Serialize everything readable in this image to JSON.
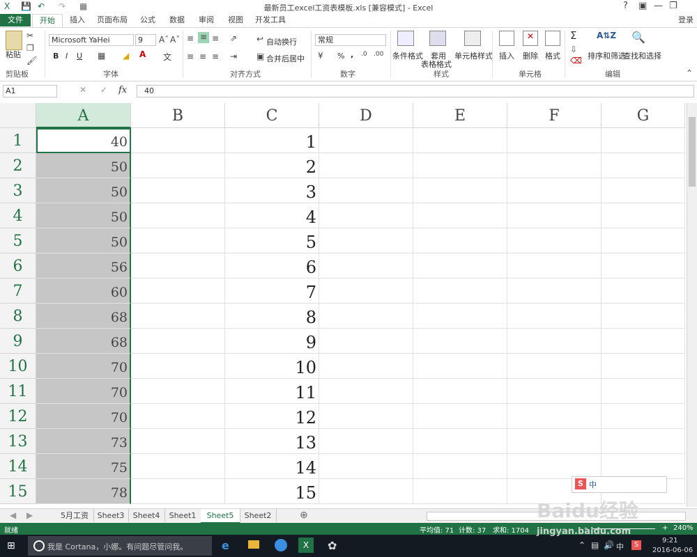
{
  "window": {
    "title": "最新员工excel工资表模板.xls  [兼容模式] - Excel",
    "help": "?",
    "login": "登录"
  },
  "ribbon_tabs": [
    "文件",
    "开始",
    "插入",
    "页面布局",
    "公式",
    "数据",
    "审阅",
    "视图",
    "开发工具"
  ],
  "ribbon": {
    "clipboard": {
      "paste": "粘贴",
      "label": "剪贴板"
    },
    "font": {
      "name": "Microsoft YaHei",
      "size": "9",
      "bold": "B",
      "italic": "I",
      "underline": "U",
      "label": "字体"
    },
    "alignment": {
      "wrap": "自动换行",
      "merge": "合并后居中",
      "label": "对齐方式"
    },
    "number": {
      "format": "常规",
      "percent": "%",
      "comma": ",",
      "label": "数字"
    },
    "styles": {
      "cond": "条件格式",
      "table1": "套用",
      "table2": "表格格式",
      "cellstyle": "单元格样式",
      "label": "样式"
    },
    "cells": {
      "insert": "插入",
      "delete": "删除",
      "format": "格式",
      "label": "单元格"
    },
    "editing": {
      "sort": "排序和筛选",
      "find": "查找和选择",
      "sigma": "Σ",
      "label": "编辑"
    }
  },
  "formula_bar": {
    "name_box": "A1",
    "fx": "fx",
    "value": "40"
  },
  "columns": [
    "A",
    "B",
    "C",
    "D",
    "E",
    "F",
    "G"
  ],
  "rows": [
    {
      "n": "1",
      "a": "40",
      "c": "1"
    },
    {
      "n": "2",
      "a": "50",
      "c": "2"
    },
    {
      "n": "3",
      "a": "50",
      "c": "3"
    },
    {
      "n": "4",
      "a": "50",
      "c": "4"
    },
    {
      "n": "5",
      "a": "50",
      "c": "5"
    },
    {
      "n": "6",
      "a": "56",
      "c": "6"
    },
    {
      "n": "7",
      "a": "60",
      "c": "7"
    },
    {
      "n": "8",
      "a": "68",
      "c": "8"
    },
    {
      "n": "9",
      "a": "68",
      "c": "9"
    },
    {
      "n": "10",
      "a": "70",
      "c": "10"
    },
    {
      "n": "11",
      "a": "70",
      "c": "11"
    },
    {
      "n": "12",
      "a": "70",
      "c": "12"
    },
    {
      "n": "13",
      "a": "73",
      "c": "13"
    },
    {
      "n": "14",
      "a": "75",
      "c": "14"
    },
    {
      "n": "15",
      "a": "78",
      "c": "15"
    }
  ],
  "sheets": [
    "5月工资",
    "Sheet3",
    "Sheet4",
    "Sheet1",
    "Sheet5",
    "Sheet2"
  ],
  "active_sheet": "Sheet5",
  "status": {
    "ready": "就绪",
    "average": "平均值: 71",
    "count": "计数: 37",
    "sum": "求和: 1704",
    "zoom": "240%"
  },
  "taskbar": {
    "cortana": "我是 Cortana，小娜。有问题尽管问我。",
    "ime": "中",
    "time": "9:21",
    "date": "2016-06-06"
  },
  "watermark": "Baidu经验",
  "watermark_url": "jingyan.baidu.com",
  "colors": {
    "excel_green": "#217346",
    "selected_cell": "#c6c6c6"
  }
}
